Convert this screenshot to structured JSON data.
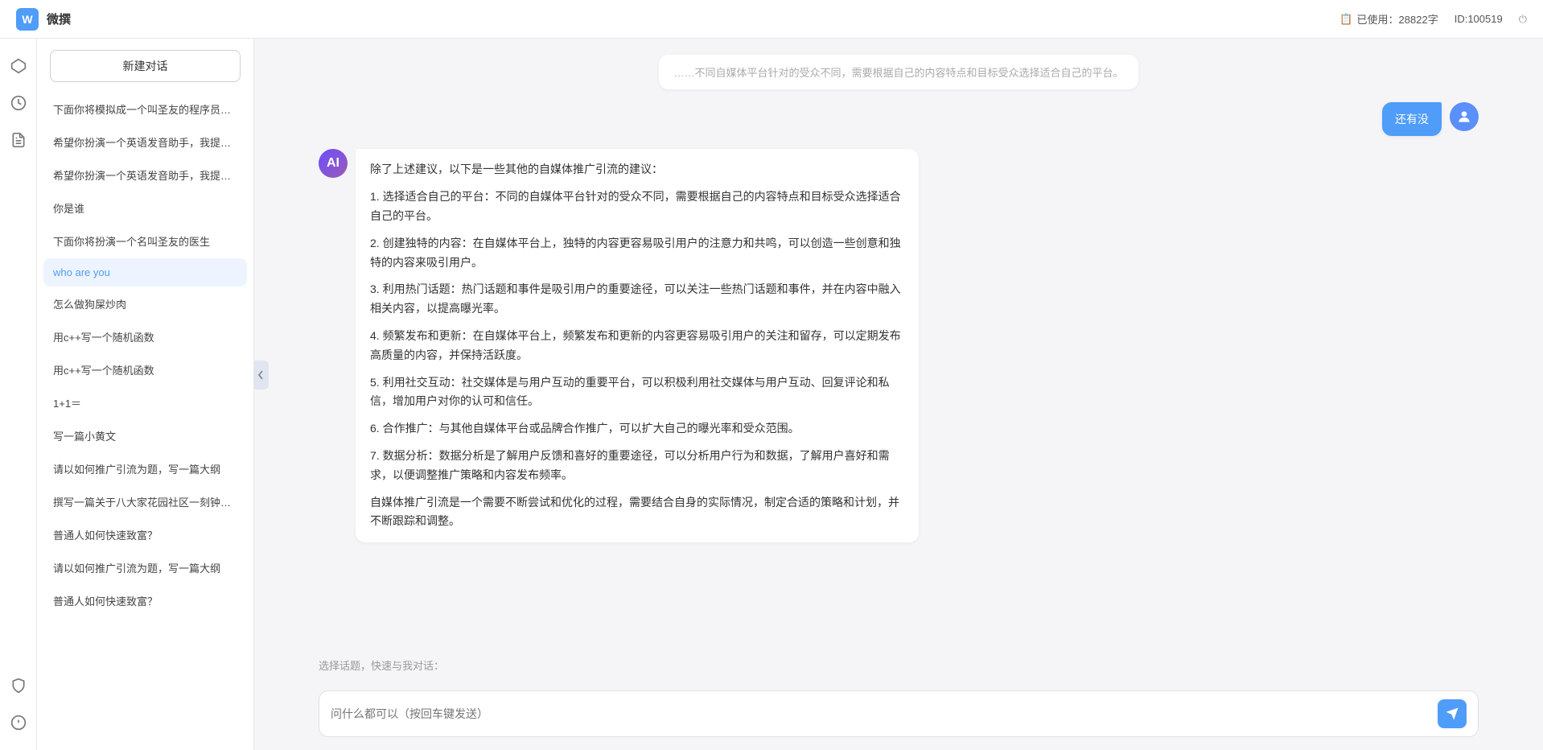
{
  "topbar": {
    "logo": "微撰",
    "w_label": "W",
    "usage_icon": "📋",
    "usage_label": "已使用：28822字",
    "id_label": "ID:100519",
    "power_icon": "⏻"
  },
  "icon_sidebar": {
    "items": [
      {
        "icon": "⬡",
        "name": "hexagon-icon",
        "active": false
      },
      {
        "icon": "🕐",
        "name": "clock-icon",
        "active": false
      },
      {
        "icon": "📄",
        "name": "document-icon",
        "active": false
      }
    ],
    "bottom_items": [
      {
        "icon": "🛡",
        "name": "shield-icon"
      },
      {
        "icon": "ℹ",
        "name": "info-icon"
      }
    ]
  },
  "conv_sidebar": {
    "new_button": "新建对话",
    "items": [
      {
        "text": "下面你将模拟成一个叫圣友的程序员，我说...",
        "active": false
      },
      {
        "text": "希望你扮演一个英语发音助手，我提供给你...",
        "active": false
      },
      {
        "text": "希望你扮演一个英语发音助手，我提供给你...",
        "active": false
      },
      {
        "text": "你是谁",
        "active": false
      },
      {
        "text": "下面你将扮演一个名叫圣友的医生",
        "active": false
      },
      {
        "text": "who are you",
        "active": true
      },
      {
        "text": "怎么做狗屎炒肉",
        "active": false
      },
      {
        "text": "用c++写一个随机函数",
        "active": false
      },
      {
        "text": "用c++写一个随机函数",
        "active": false
      },
      {
        "text": "1+1＝",
        "active": false
      },
      {
        "text": "写一篇小黄文",
        "active": false
      },
      {
        "text": "请以如何推广引流为题，写一篇大纲",
        "active": false
      },
      {
        "text": "撰写一篇关于八大家花园社区一刻钟便民生...",
        "active": false
      },
      {
        "text": "普通人如何快速致富？",
        "active": false
      },
      {
        "text": "请以如何推广引流为题，写一篇大纲",
        "active": false
      },
      {
        "text": "普通人如何快速致富？",
        "active": false
      }
    ]
  },
  "chat": {
    "partial_top_message": "……不同自媒体平台针对的受众不同，需要根据自己的内容特点和目标受众选择适合自己的平台。",
    "user_question": "还有没",
    "ai_response": {
      "paragraphs": [
        "除了上述建议，以下是一些其他的自媒体推广引流的建议：",
        "1. 选择适合自己的平台：不同的自媒体平台针对的受众不同，需要根据自己的内容特点和目标受众选择适合自己的平台。",
        "2. 创建独特的内容：在自媒体平台上，独特的内容更容易吸引用户的注意力和共鸣，可以创造一些创意和独特的内容来吸引用户。",
        "3. 利用热门话题：热门话题和事件是吸引用户的重要途径，可以关注一些热门话题和事件，并在内容中融入相关内容，以提高曝光率。",
        "4. 频繁发布和更新：在自媒体平台上，频繁发布和更新的内容更容易吸引用户的关注和留存，可以定期发布高质量的内容，并保持活跃度。",
        "5. 利用社交互动：社交媒体是与用户互动的重要平台，可以积极利用社交媒体与用户互动、回复评论和私信，增加用户对你的认可和信任。",
        "6. 合作推广：与其他自媒体平台或品牌合作推广，可以扩大自己的曝光率和受众范围。",
        "7. 数据分析：数据分析是了解用户反馈和喜好的重要途径，可以分析用户行为和数据，了解用户喜好和需求，以便调整推广策略和内容发布频率。",
        "自媒体推广引流是一个需要不断尝试和优化的过程，需要结合自身的实际情况，制定合适的策略和计划，并不断跟踪和调整。"
      ]
    },
    "quick_topics_label": "选择话题，快速与我对话：",
    "input_placeholder": "问什么都可以（按回车键发送）"
  }
}
